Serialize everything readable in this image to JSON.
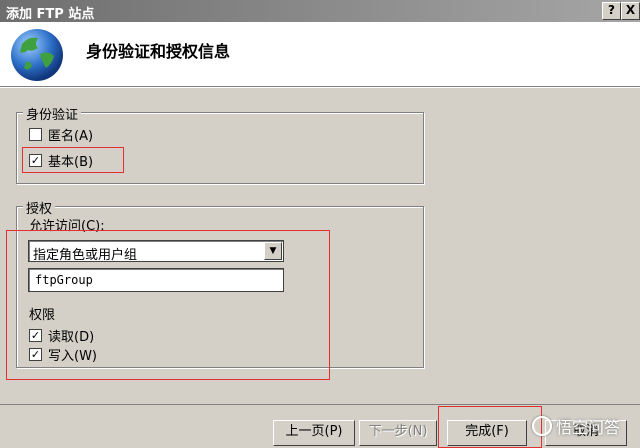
{
  "window": {
    "title": "添加 FTP 站点",
    "help_button": "?",
    "close_button": "X"
  },
  "header": {
    "title": "身份验证和授权信息"
  },
  "authentication": {
    "legend": "身份验证",
    "anonymous": {
      "label": "匿名(A)",
      "checked": false
    },
    "basic": {
      "label": "基本(B)",
      "checked": true
    }
  },
  "authorization": {
    "legend": "授权",
    "allow_access_label": "允许访问(C):",
    "allow_access_value": "指定角色或用户组",
    "group_value": "ftpGroup",
    "permissions_label": "权限",
    "read": {
      "label": "读取(D)",
      "checked": true
    },
    "write": {
      "label": "写入(W)",
      "checked": true
    }
  },
  "buttons": {
    "prev": "上一页(P)",
    "next": "下一步(N)",
    "finish": "完成(F)",
    "cancel": "取消"
  },
  "watermark": {
    "text": "悟空问答"
  },
  "colors": {
    "highlight_border": "#e03030",
    "dialog_bg": "#d4d0c8"
  }
}
